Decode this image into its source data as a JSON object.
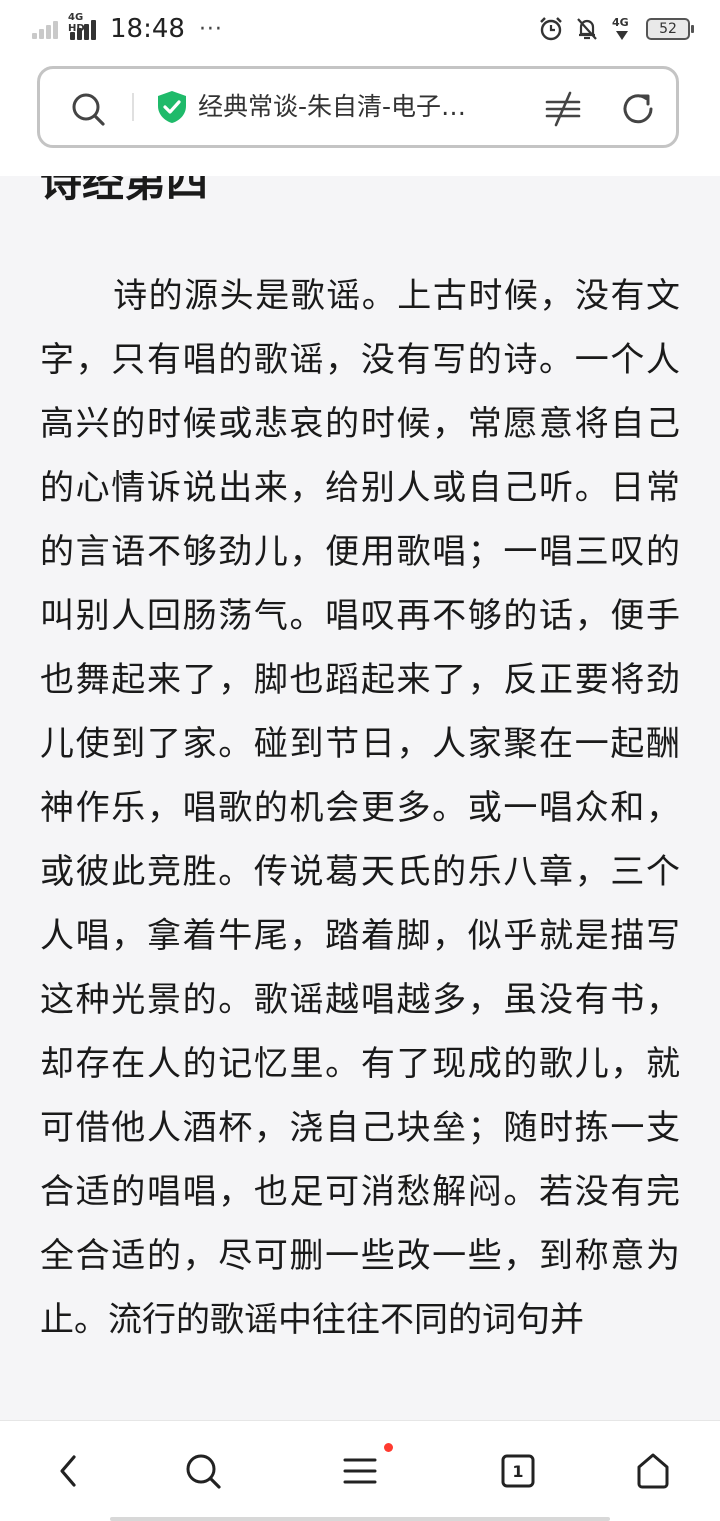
{
  "status_bar": {
    "time": "18:48",
    "dots": "···",
    "network_label": "4G HD",
    "network2_label": "4G",
    "battery": "52"
  },
  "address_bar": {
    "title": "经典常谈-朱自清-电子…",
    "icons": [
      "search-icon",
      "shield-check-icon",
      "reader-mode-icon",
      "reload-icon"
    ],
    "shield_color": "#1fba6a"
  },
  "article": {
    "chapter_title": "诗经第四",
    "paragraph": "诗的源头是歌谣。上古时候，没有文字，只有唱的歌谣，没有写的诗。一个人高兴的时候或悲哀的时候，常愿意将自己的心情诉说出来，给别人或自己听。日常的言语不够劲儿，便用歌唱；一唱三叹的叫别人回肠荡气。唱叹再不够的话，便手也舞起来了，脚也蹈起来了，反正要将劲儿使到了家。碰到节日，人家聚在一起酬神作乐，唱歌的机会更多。或一唱众和，或彼此竞胜。传说葛天氏的乐八章，三个人唱，拿着牛尾，踏着脚，似乎就是描写这种光景的。歌谣越唱越多，虽没有书，却存在人的记忆里。有了现成的歌儿，就可借他人酒杯，浇自己块垒；随时拣一支合适的唱唱，也足可消愁解闷。若没有完全合适的，尽可删一些改一些，到称意为止。流行的歌谣中往往不同的词句并"
  },
  "bottom_nav": {
    "tab_count": "1",
    "icons": [
      "back-icon",
      "search-icon",
      "menu-icon",
      "tabs-icon",
      "home-icon"
    ],
    "menu_badge_color": "#ff3b30"
  }
}
